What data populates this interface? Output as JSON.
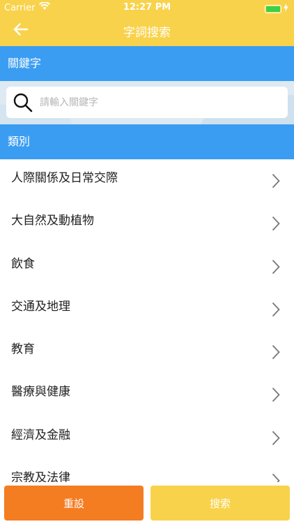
{
  "status_bar": {
    "carrier": "Carrier",
    "time": "12:27 PM",
    "battery_level": 1.0
  },
  "nav": {
    "title": "字詞搜索",
    "back_icon": "arrow-left-icon"
  },
  "keyword_section": {
    "header": "關鍵字",
    "placeholder": "請輸入關鍵字",
    "value": ""
  },
  "category_section": {
    "header": "類別",
    "items": [
      {
        "label": "人際關係及日常交際"
      },
      {
        "label": "大自然及動植物"
      },
      {
        "label": "飲食"
      },
      {
        "label": "交通及地理"
      },
      {
        "label": "教育"
      },
      {
        "label": "醫療與健康"
      },
      {
        "label": "經濟及金融"
      },
      {
        "label": "宗教及法律"
      }
    ]
  },
  "actions": {
    "reset_label": "重設",
    "search_label": "搜索"
  },
  "colors": {
    "header_yellow": "#f8d24a",
    "section_blue": "#3a9df2",
    "reset_orange": "#f47c21",
    "battery_green": "#3ad24a"
  }
}
